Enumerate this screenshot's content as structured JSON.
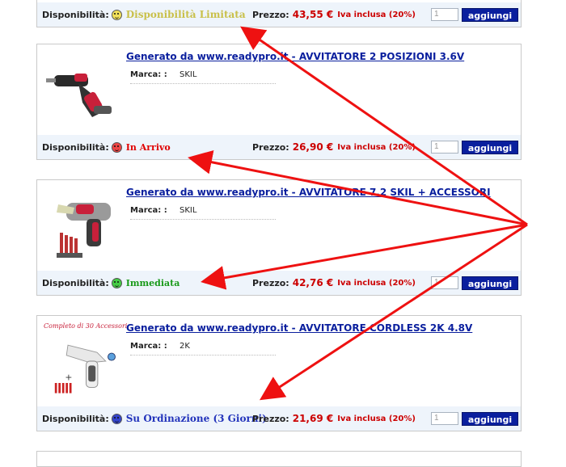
{
  "labels": {
    "disponibilita": "Disponibilità:",
    "prezzo": "Prezzo:",
    "iva": "Iva inclusa (20%)",
    "marca": "Marca: :",
    "add_button": "aggiungi",
    "qty_placeholder": "1"
  },
  "colors": {
    "status_limited": "#c9c04a",
    "status_arrival": "#e00000",
    "status_immediate": "#1a9a1a",
    "status_order": "#2233bb",
    "price": "#cc0000",
    "button": "#0a1f9e",
    "arrow": "#ee1111"
  },
  "products": [
    {
      "title": "",
      "brand": "",
      "status": "Disponibilità Limitata",
      "status_icon": "neutral-smiley-icon",
      "price": "43,55 €"
    },
    {
      "title": "Generato da www.readypro.it - AVVITATORE 2 POSIZIONI 3.6V",
      "brand": "SKIL",
      "status": "In Arrivo",
      "status_icon": "sad-smiley-icon",
      "price": "26,90 €"
    },
    {
      "title": "Generato da www.readypro.it - AVVITATORE 7.2 SKIL + ACCESSORI",
      "brand": "SKIL",
      "status": "Immediata",
      "status_icon": "happy-smiley-icon",
      "price": "42,76 €"
    },
    {
      "title": "Generato da www.readypro.it - AVVITATORE CORDLESS 2K 4.8V",
      "brand": "2K",
      "status": "Su Ordinazione (3 Giorni)",
      "status_icon": "blue-smiley-icon",
      "price": "21,69 €",
      "image_caption": "Completo di 30 Accessori"
    }
  ]
}
